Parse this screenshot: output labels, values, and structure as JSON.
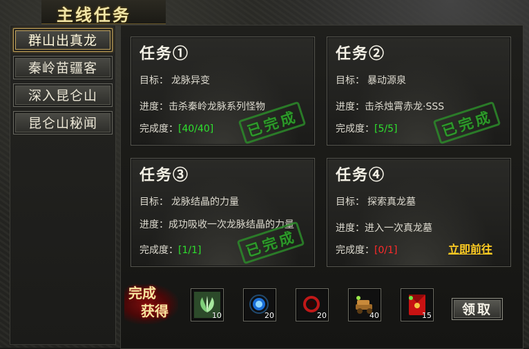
{
  "window": {
    "title": "主线任务"
  },
  "sidebar": {
    "items": [
      {
        "label": "群山出真龙",
        "active": true
      },
      {
        "label": "秦岭苗疆客",
        "active": false
      },
      {
        "label": "深入昆仑山",
        "active": false
      },
      {
        "label": "昆仑山秘闻",
        "active": false
      }
    ]
  },
  "quests": [
    {
      "title": "任务①",
      "goal_label": "目标：",
      "goal": "龙脉异变",
      "progress_label": "进度：",
      "progress": "击杀秦岭龙脉系列怪物",
      "completion_label": "完成度：",
      "completion": "[40/40]",
      "completed": true,
      "stamp": "已完成"
    },
    {
      "title": "任务②",
      "goal_label": "目标：",
      "goal": "暴动源泉",
      "progress_label": "进度：",
      "progress": "击杀烛霄赤龙·SSS",
      "completion_label": "完成度：",
      "completion": "[5/5]",
      "completed": true,
      "stamp": "已完成"
    },
    {
      "title": "任务③",
      "goal_label": "目标：",
      "goal": "龙脉结晶的力量",
      "progress_label": "进度：",
      "progress": "成功吸收一次龙脉结晶的力量",
      "completion_label": "完成度：",
      "completion": "[1/1]",
      "completed": true,
      "stamp": "已完成"
    },
    {
      "title": "任务④",
      "goal_label": "目标：",
      "goal": "探索真龙墓",
      "progress_label": "进度：",
      "progress": "进入一次真龙墓",
      "completion_label": "完成度：",
      "completion": "[0/1]",
      "completed": false,
      "goto_label": "立即前往"
    }
  ],
  "rewards": {
    "label_line1": "完成",
    "label_line2": "获得",
    "items": [
      {
        "icon": "herb-icon",
        "count": "10"
      },
      {
        "icon": "blue-orb-icon",
        "count": "20"
      },
      {
        "icon": "red-ring-icon",
        "count": "20"
      },
      {
        "icon": "cannon-icon",
        "count": "40"
      },
      {
        "icon": "red-envelope-icon",
        "count": "15"
      }
    ],
    "claim_label": "领取"
  },
  "colors": {
    "complete_green": "#2ee02e",
    "incomplete_red": "#ff2a2a",
    "goto_gold": "#ffcc22",
    "title_gold": "#f2e6a8"
  }
}
